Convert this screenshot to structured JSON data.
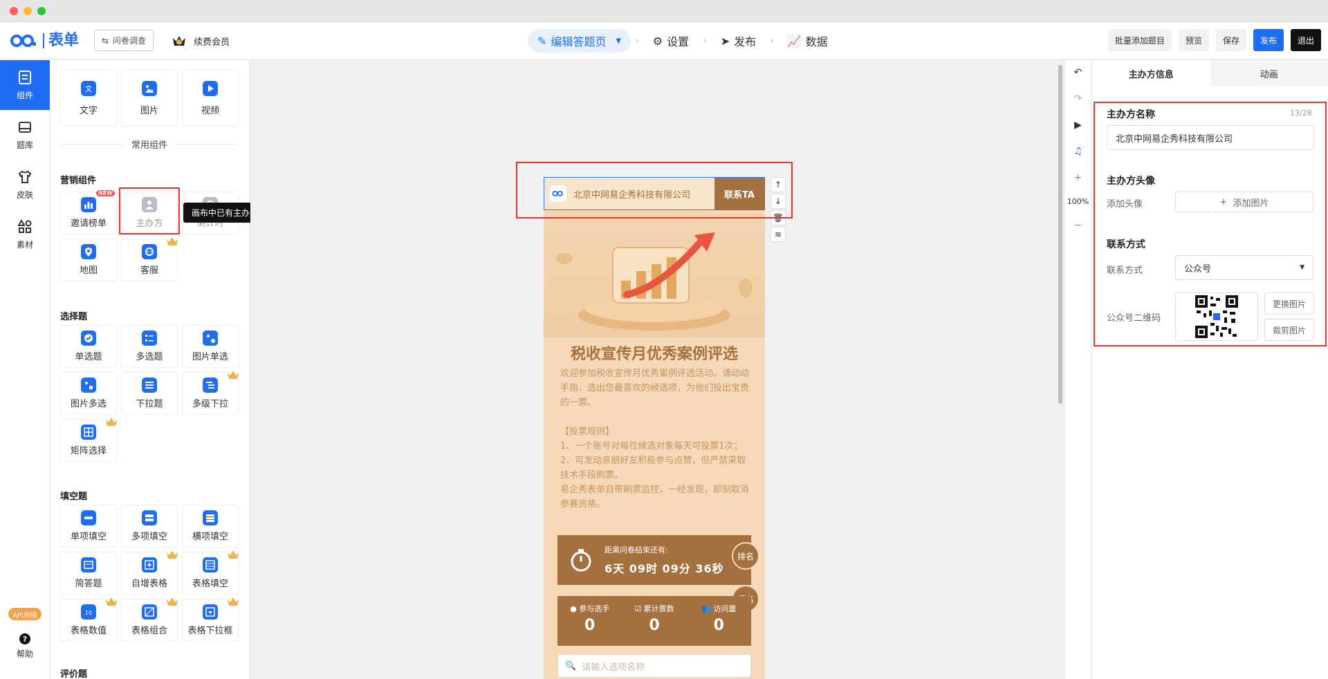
{
  "window": {
    "traffic_lights": [
      "close",
      "minimize",
      "maximize"
    ]
  },
  "header": {
    "logo_text": "表单",
    "form_type": "问卷调查",
    "vip_label": "续费会员",
    "steps": [
      {
        "label": "编辑答题页",
        "active": true
      },
      {
        "label": "设置",
        "active": false
      },
      {
        "label": "发布",
        "active": false
      },
      {
        "label": "数据",
        "active": false
      }
    ],
    "actions": {
      "batch": "批量添加题目",
      "preview": "预览",
      "save": "保存",
      "publish": "发布",
      "exit": "退出"
    }
  },
  "rail": {
    "items": [
      {
        "label": "组件",
        "active": true
      },
      {
        "label": "题库",
        "active": false
      },
      {
        "label": "皮肤",
        "active": false
      },
      {
        "label": "素材",
        "active": false
      }
    ],
    "api_badge": "API对接",
    "help": "帮助"
  },
  "panel": {
    "basic": [
      "文字",
      "图片",
      "视频"
    ],
    "common_label": "常用组件",
    "marketing_title": "营销组件",
    "marketing": [
      {
        "label": "邀请榜单",
        "badge": "NEW"
      },
      {
        "label": "主办方",
        "disabled": true
      },
      {
        "label": "倒计时",
        "disabled": true
      },
      {
        "label": "地图"
      },
      {
        "label": "客服",
        "crown": true
      }
    ],
    "choice_title": "选择题",
    "choice": [
      {
        "label": "单选题"
      },
      {
        "label": "多选题"
      },
      {
        "label": "图片单选"
      },
      {
        "label": "图片多选"
      },
      {
        "label": "下拉题"
      },
      {
        "label": "多级下拉",
        "crown": true
      },
      {
        "label": "矩阵选择",
        "crown": true
      }
    ],
    "fill_title": "填空题",
    "fill": [
      {
        "label": "单项填空"
      },
      {
        "label": "多项填空"
      },
      {
        "label": "横项填空"
      },
      {
        "label": "简答题"
      },
      {
        "label": "自增表格",
        "crown": true
      },
      {
        "label": "表格填空",
        "crown": true
      },
      {
        "label": "表格数值",
        "crown": true
      },
      {
        "label": "表格组合",
        "crown": true
      },
      {
        "label": "表格下拉框",
        "crown": true
      }
    ],
    "rating_title": "评价题",
    "tooltip": "画布中已有主办方信息，请勿重复添加"
  },
  "canvas": {
    "sponsor_name": "北京中网易企秀科技有限公司",
    "contact_btn": "联系TA",
    "title": "税收宣传月优秀案例评选",
    "description": "欢迎参加税收宣传月优秀案例评选活动。请动动手指，选出您最喜欢的候选项，为他们投出宝贵的一票。\n\n【投票规则】\n1、一个账号对每位候选对象每天可投票1次；\n2、可发动亲朋好友积极参与点赞，但严禁采取技术手段刷票。\n易企秀表单自带刷票监控，一经发现，即刻取消参赛资格。",
    "timer_label": "距离问卷结束还有:",
    "timer_value": "6天 09时 09分 36秒",
    "rank_btn": "排名",
    "signup_btn": "报名",
    "stats": [
      {
        "label": "参与选手",
        "value": "0"
      },
      {
        "label": "累计票数",
        "value": "0"
      },
      {
        "label": "访问量",
        "value": "0"
      }
    ],
    "search_placeholder": "请输入选项名称"
  },
  "tools": {
    "zoom": "100%"
  },
  "props": {
    "tabs": [
      "主办方信息",
      "动画"
    ],
    "name_title": "主办方名称",
    "name_count": "13/28",
    "name_value": "北京中网易企秀科技有限公司",
    "avatar_title": "主办方头像",
    "avatar_label": "添加头像",
    "avatar_btn": "添加图片",
    "contact_title": "联系方式",
    "contact_label": "联系方式",
    "contact_value": "公众号",
    "qr_label": "公众号二维码",
    "replace_btn": "更换图片",
    "crop_btn": "裁剪图片"
  },
  "colors": {
    "accent": "#1e6df3",
    "highlight": "#e8302f",
    "brown": "#a4703f",
    "phone_bg": "#f6d9b8"
  }
}
